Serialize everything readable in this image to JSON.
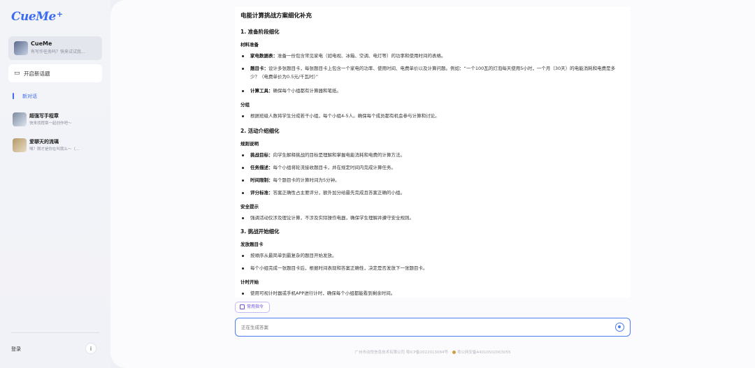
{
  "app": {
    "logo_text": "CueMe",
    "logo_plus": "+"
  },
  "sidebar": {
    "agent_card": {
      "name": "CueMe",
      "desc": "有写作任务吗？快来试试我..."
    },
    "new_chat_label": "开启新话题",
    "current_conversation": "新对话",
    "agents": [
      {
        "name": "超强写手程章",
        "desc": "快来找程章一起创作吧～"
      },
      {
        "name": "爱聊天的流璃",
        "desc": "嘿？刚才是你在叫我么～（..."
      }
    ],
    "login_label": "登录",
    "info_icon": "i"
  },
  "doc": {
    "title": "电能计算挑战方案细化补充",
    "s1": {
      "heading": "1. 准备阶段细化"
    },
    "materials": {
      "heading": "材料准备",
      "items": [
        {
          "label": "家电数据表：",
          "text": "准备一份包含常见家电（如电视、冰箱、空调、电灯等）的功率和使用时间的表格。"
        },
        {
          "label": "题目卡：",
          "text": "设计多张题目卡，每张题目卡上包含一个家电的功率、使用时间、电费单价以及计算问题。例如：“一个100瓦的灯泡每天使用5小时，一个月（30天）的电能消耗和电费是多少？（电费单价为0.5元/千瓦时）”"
        },
        {
          "label": "计算工具：",
          "text": "确保每个小组都有计算器和笔纸。"
        }
      ]
    },
    "grouping": {
      "heading": "分组",
      "items": [
        {
          "label": "",
          "text": "根据班级人数将学生分成若干小组，每个小组4-5人。确保每个成员都有机会参与计算和讨论。"
        }
      ]
    },
    "s2": {
      "heading": "2. 活动介绍细化"
    },
    "rules": {
      "heading": "规则说明",
      "items": [
        {
          "label": "挑战目标：",
          "text": "向学生解释挑战的目标是理解和掌握电能消耗和电费的计算方法。"
        },
        {
          "label": "任务描述：",
          "text": "每个小组将轮流接收题目卡，并在规定时间内完成计算任务。"
        },
        {
          "label": "时间限制：",
          "text": "每个题目卡的计算时间为5分钟。"
        },
        {
          "label": "评分标准：",
          "text": "答案正确性占主要评分，额外加分给最先完成且答案正确的小组。"
        }
      ]
    },
    "safety": {
      "heading": "安全提示",
      "items": [
        {
          "label": "",
          "text": "强调活动仅涉及理论计算，不涉及实际操作电器，确保学生理解并遵守安全规则。"
        }
      ]
    },
    "s3": {
      "heading": "3. 挑战开始细化"
    },
    "distribute": {
      "heading": "发放题目卡",
      "items": [
        {
          "label": "",
          "text": "按顺序从最简单到最复杂的题目开始发放。"
        },
        {
          "label": "",
          "text": "每个小组完成一张题目卡后，根据时间表现和答案正确性，决定是否发放下一张题目卡。"
        }
      ]
    },
    "timing": {
      "heading": "计时开始",
      "items": [
        {
          "label": "",
          "text": "使用可视计时器或手机APP进行计时，确保每个小组都能看到剩余时间。"
        }
      ]
    }
  },
  "input": {
    "command_label": "常用指令",
    "placeholder": "正在生成答案"
  },
  "footer": {
    "company": "广州市动悦信息技术有限公司 粤ICP备2022013084号",
    "police": "粤公网安备44010502003055"
  },
  "colors": {
    "accent": "#3d6cf0",
    "command": "#6a4fd8"
  }
}
